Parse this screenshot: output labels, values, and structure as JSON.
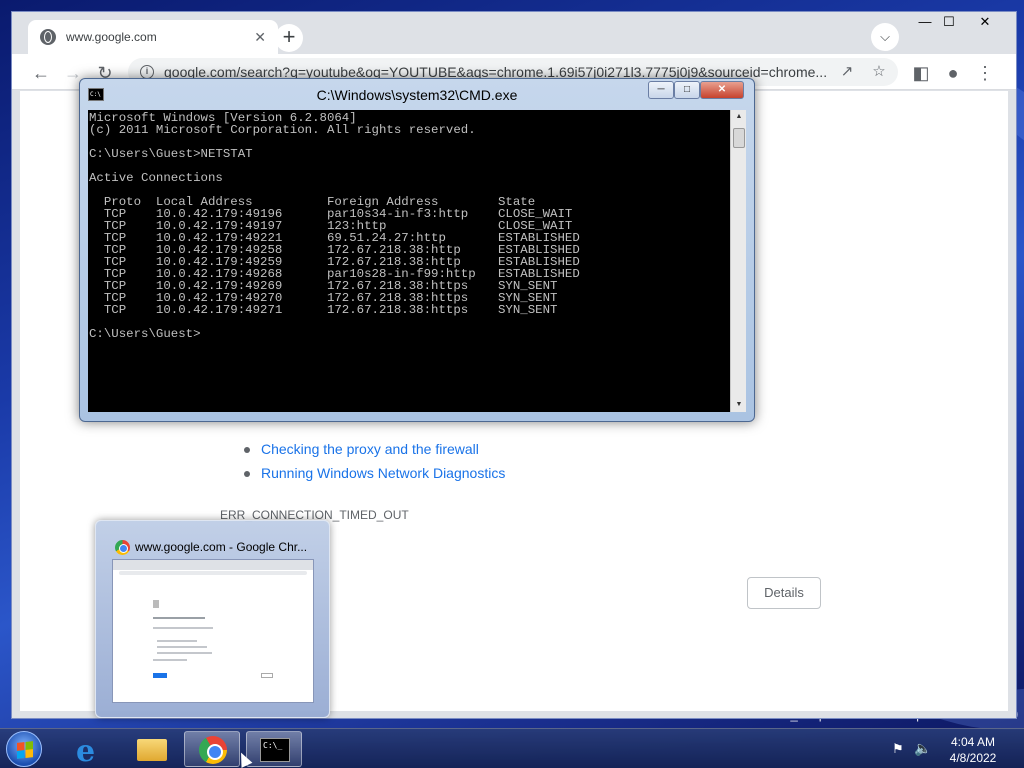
{
  "desktop": {
    "build_text": "Build 6064.fbl_ecap.110600-1600.5p5ct95e1ec5sec0"
  },
  "browser": {
    "tab_title": "www.google.com",
    "tab_close": "✕",
    "new_tab": "+",
    "url": "google.com/search?q=youtube&oq=YOUTUBE&aqs=chrome.1.69i57j0i271l3.7775j0j9&sourceid=chrome...",
    "window_controls": {
      "minimize": "—",
      "maximize": "☐",
      "close": "✕"
    },
    "page": {
      "bullets": [
        "Checking the proxy and the firewall",
        "Running Windows Network Diagnostics"
      ],
      "error_code": "ERR_CONNECTION_TIMED_OUT",
      "details_label": "Details"
    }
  },
  "cmd": {
    "title": "C:\\Windows\\system32\\CMD.exe",
    "lines": [
      "Microsoft Windows [Version 6.2.8064]",
      "(c) 2011 Microsoft Corporation. All rights reserved.",
      "",
      "C:\\Users\\Guest>NETSTAT",
      "",
      "Active Connections",
      "",
      "  Proto  Local Address          Foreign Address        State",
      "  TCP    10.0.42.179:49196      par10s34-in-f3:http    CLOSE_WAIT",
      "  TCP    10.0.42.179:49197      123:http               CLOSE_WAIT",
      "  TCP    10.0.42.179:49221      69.51.24.27:http       ESTABLISHED",
      "  TCP    10.0.42.179:49258      172.67.218.38:http     ESTABLISHED",
      "  TCP    10.0.42.179:49259      172.67.218.38:http     ESTABLISHED",
      "  TCP    10.0.42.179:49268      par10s28-in-f99:http   ESTABLISHED",
      "  TCP    10.0.42.179:49269      172.67.218.38:https    SYN_SENT",
      "  TCP    10.0.42.179:49270      172.67.218.38:https    SYN_SENT",
      "  TCP    10.0.42.179:49271      172.67.218.38:https    SYN_SENT",
      "",
      "C:\\Users\\Guest>"
    ]
  },
  "preview": {
    "title": "www.google.com - Google Chr..."
  },
  "taskbar": {
    "clock_time": "4:04 AM",
    "clock_date": "4/8/2022",
    "cmd_icon_text": "C:\\_"
  }
}
